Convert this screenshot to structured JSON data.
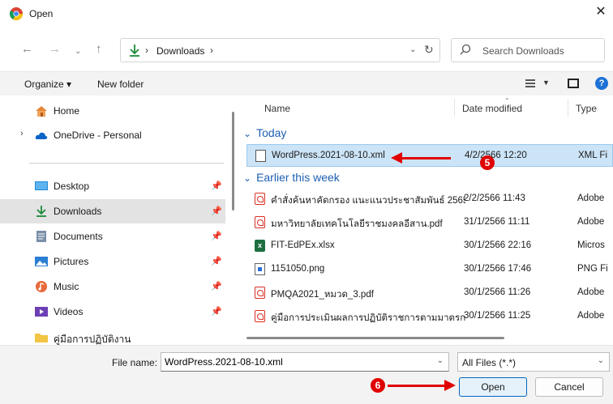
{
  "window": {
    "title": "Open",
    "close_label": "✕"
  },
  "address": {
    "path_segment": "Downloads",
    "search_placeholder": "Search Downloads"
  },
  "toolbar": {
    "organize_label": "Organize ▾",
    "new_folder_label": "New folder"
  },
  "nav": {
    "items": [
      {
        "label": "Home"
      },
      {
        "label": "OneDrive - Personal"
      },
      {
        "label": "Desktop"
      },
      {
        "label": "Downloads"
      },
      {
        "label": "Documents"
      },
      {
        "label": "Pictures"
      },
      {
        "label": "Music"
      },
      {
        "label": "Videos"
      },
      {
        "label": "คู่มือการปฏิบัติงาน"
      }
    ]
  },
  "columns": {
    "name": "Name",
    "date": "Date modified",
    "type": "Type"
  },
  "groups": {
    "today": "Today",
    "earlier": "Earlier this week"
  },
  "files": [
    {
      "name": "WordPress.2021-08-10.xml",
      "date": "4/2/2566 12:20",
      "type": "XML Fi"
    },
    {
      "name": "คำสั่งค้นหาคัดกรอง แนะแนวประชาสัมพันธ์ 2565....",
      "date": "2/2/2566 11:43",
      "type": "Adobe"
    },
    {
      "name": "มหาวิทยาลัยเทคโนโลยีราชมงคลอีสาน.pdf",
      "date": "31/1/2566 11:11",
      "type": "Adobe"
    },
    {
      "name": "FIT-EdPEx.xlsx",
      "date": "30/1/2566 22:16",
      "type": "Micros"
    },
    {
      "name": "1151050.png",
      "date": "30/1/2566 17:46",
      "type": "PNG Fi"
    },
    {
      "name": "PMQA2021_หมวด_3.pdf",
      "date": "30/1/2566 11:26",
      "type": "Adobe"
    },
    {
      "name": "คู่มือการประเมินผลการปฏิบัติราชการตามมาตรกา...",
      "date": "30/1/2566 11:25",
      "type": "Adobe"
    }
  ],
  "footer": {
    "file_name_label": "File name:",
    "file_name_value": "WordPress.2021-08-10.xml",
    "file_type": "All Files (*.*)",
    "open_label": "Open",
    "cancel_label": "Cancel"
  },
  "annotations": {
    "step5": "5",
    "step6": "6",
    "color": "#e00000"
  }
}
